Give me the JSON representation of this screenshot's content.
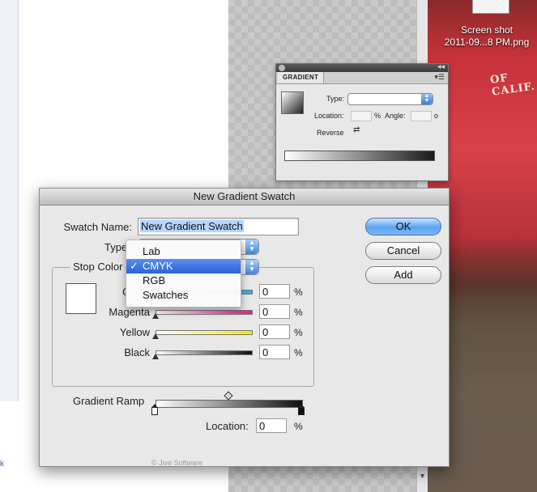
{
  "desktop": {
    "file_caption_line1": "Screen shot",
    "file_caption_line2": "2011-09...8 PM.png",
    "photo_text": "OF CALIF.",
    "left_link": "k"
  },
  "gradient_panel": {
    "tab": "GRADIENT",
    "type_label": "Type:",
    "location_label": "Location:",
    "location_unit": "%",
    "angle_label": "Angle:",
    "angle_unit": "o",
    "reverse_label": "Reverse"
  },
  "dialog": {
    "title": "New Gradient Swatch",
    "swatch_name_label": "Swatch Name:",
    "swatch_name_value": "New Gradient Swatch",
    "type_label": "Type",
    "stop_color_label": "Stop Color",
    "sliders": [
      {
        "label": "C",
        "value": "0",
        "unit": "%",
        "color": "#2ea8e6"
      },
      {
        "label": "Magenta",
        "value": "0",
        "unit": "%",
        "color": "#e0208c"
      },
      {
        "label": "Yellow",
        "value": "0",
        "unit": "%",
        "color": "#f6e800"
      },
      {
        "label": "Black",
        "value": "0",
        "unit": "%",
        "color": "#101010"
      }
    ],
    "gradient_ramp_label": "Gradient Ramp",
    "location_label": "Location:",
    "location_value": "0",
    "location_unit": "%",
    "buttons": {
      "ok": "OK",
      "cancel": "Cancel",
      "add": "Add"
    },
    "footer_text": "© Jive Software"
  },
  "stop_color_menu": {
    "items": [
      {
        "label": "Lab",
        "selected": false
      },
      {
        "label": "CMYK",
        "selected": true
      },
      {
        "label": "RGB",
        "selected": false
      },
      {
        "label": "Swatches",
        "selected": false
      }
    ],
    "check": "✓"
  }
}
